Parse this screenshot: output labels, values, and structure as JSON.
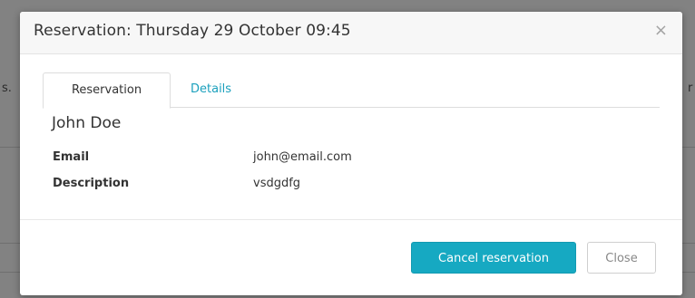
{
  "background": {
    "left_fragment": "s.",
    "right_fragment": "r"
  },
  "modal": {
    "title": "Reservation: Thursday 29 October 09:45",
    "close_icon": "close-icon",
    "close_glyph": "×"
  },
  "tabs": [
    {
      "label": "Reservation",
      "active": true
    },
    {
      "label": "Details",
      "active": false
    }
  ],
  "reservation": {
    "name": "John Doe",
    "fields": [
      {
        "label": "Email",
        "value": "john@email.com"
      },
      {
        "label": "Description",
        "value": "vsdgdfg"
      }
    ]
  },
  "footer": {
    "cancel_label": "Cancel reservation",
    "close_label": "Close"
  },
  "colors": {
    "accent": "#16a9c2",
    "link": "#1ba0bd",
    "overlay": "#828282"
  }
}
